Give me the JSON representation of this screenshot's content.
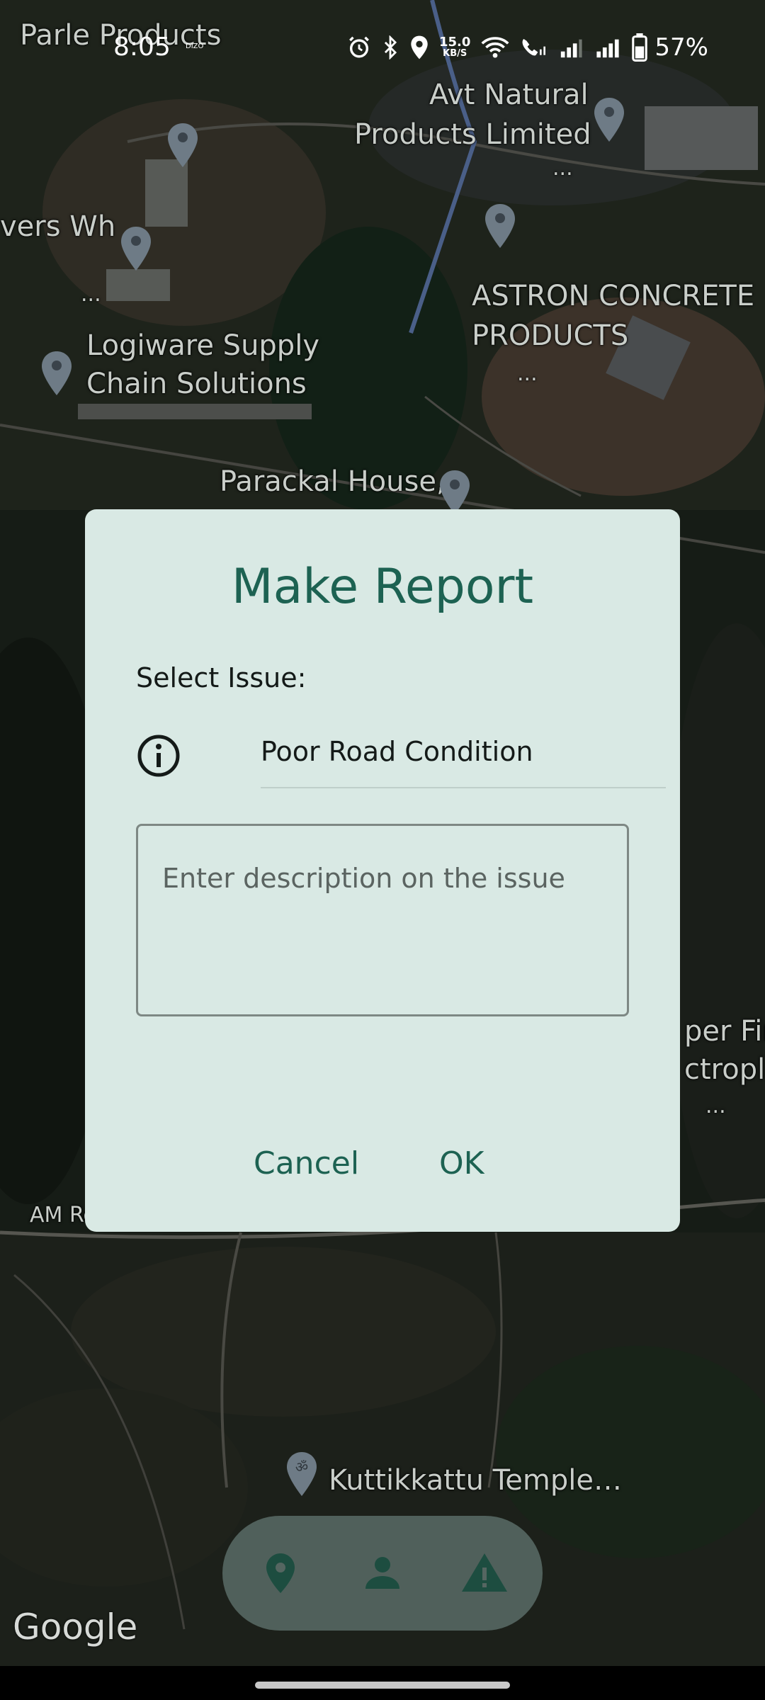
{
  "status_bar": {
    "time": "8:05",
    "brand_badge": "DIZO",
    "net_speed_value": "15.0",
    "net_speed_unit": "KB/S",
    "battery_percent": "57%"
  },
  "map": {
    "labels": {
      "parle": "Parle Products",
      "avt_line1": "Avt Natural",
      "avt_line2": "Products Limited",
      "avt_more": "...",
      "vers": "vers Wh",
      "vers_more": "...",
      "logiware_line1": "Logiware Supply",
      "logiware_line2": "Chain Solutions",
      "astron_line1": "ASTRON CONCRETE",
      "astron_line2": "PRODUCTS",
      "astron_more": "...",
      "parackal": "Parackal House,",
      "fini": "per Fini",
      "troplat": "ctroplat",
      "right_more": "...",
      "am_road": "AM Ro",
      "temple": "Kuttikkattu Temple…"
    },
    "attribution": "Google"
  },
  "dialog": {
    "title": "Make Report",
    "select_label": "Select Issue:",
    "selected_issue": "Poor Road Condition",
    "description_placeholder": "Enter description on the issue",
    "cancel_label": "Cancel",
    "ok_label": "OK"
  },
  "colors": {
    "dialog_bg": "#d9e9e4",
    "accent": "#1d6252",
    "nav_bg": "#556661"
  },
  "bottom_nav": {
    "items": [
      {
        "icon": "location-pin-icon"
      },
      {
        "icon": "person-icon"
      },
      {
        "icon": "warning-icon"
      }
    ]
  }
}
